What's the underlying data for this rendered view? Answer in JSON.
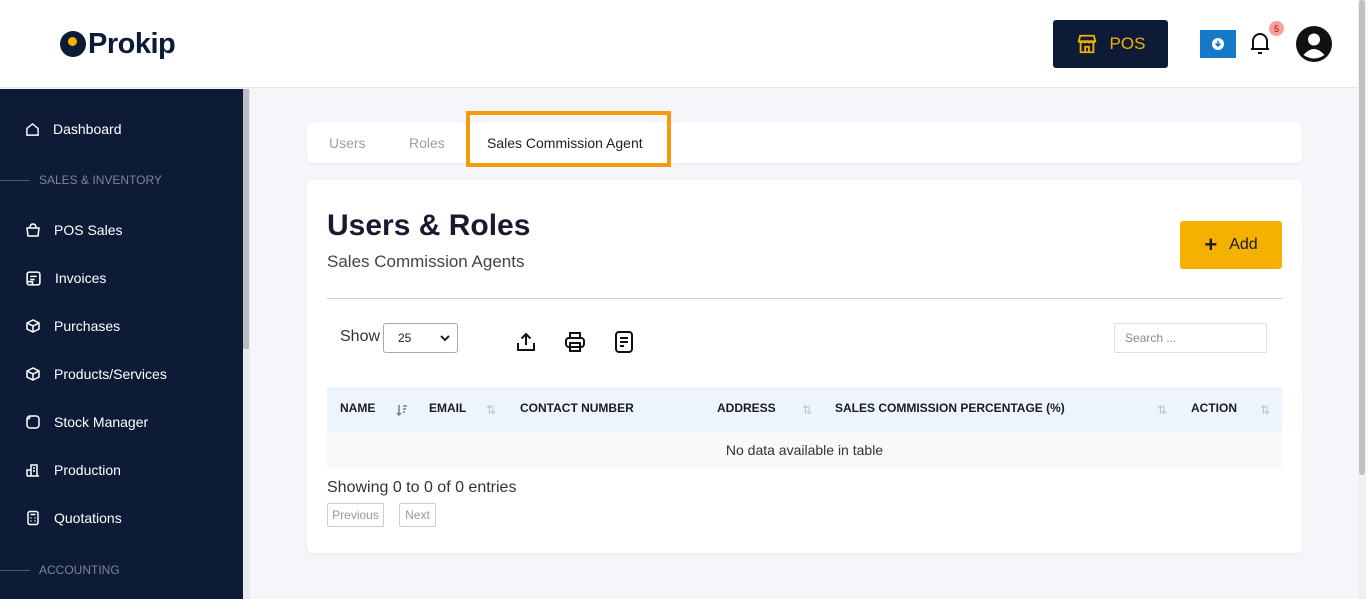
{
  "brand": {
    "name": "Prokip"
  },
  "header": {
    "pos_label": "POS",
    "notification_count": "5"
  },
  "sidebar": {
    "items": [
      {
        "label": "Dashboard",
        "icon": "home-icon"
      },
      {
        "section": "SALES & INVENTORY"
      },
      {
        "label": "POS Sales",
        "icon": "bag-icon"
      },
      {
        "label": "Invoices",
        "icon": "invoice-icon"
      },
      {
        "label": "Purchases",
        "icon": "box-icon"
      },
      {
        "label": "Products/Services",
        "icon": "cube-icon"
      },
      {
        "label": "Stock Manager",
        "icon": "stock-icon"
      },
      {
        "label": "Production",
        "icon": "factory-icon"
      },
      {
        "label": "Quotations",
        "icon": "calculator-icon"
      },
      {
        "section": "ACCOUNTING"
      }
    ]
  },
  "tabs": [
    {
      "label": "Users",
      "active": false
    },
    {
      "label": "Roles",
      "active": false
    },
    {
      "label": "Sales Commission Agent",
      "active": true
    }
  ],
  "page": {
    "title": "Users & Roles",
    "subtitle": "Sales Commission Agents",
    "add_label": "Add"
  },
  "controls": {
    "show_label": "Show",
    "page_size": "25",
    "search_placeholder": "Search ..."
  },
  "table": {
    "columns": [
      "NAME",
      "EMAIL",
      "CONTACT NUMBER",
      "ADDRESS",
      "SALES COMMISSION PERCENTAGE (%)",
      "ACTION"
    ],
    "empty_message": "No data available in table"
  },
  "footer": {
    "info": "Showing 0 to 0 of 0 entries",
    "previous": "Previous",
    "next": "Next"
  },
  "colors": {
    "navy": "#0d1b36",
    "accent": "#f5b100",
    "highlight": "#f59b0b"
  }
}
